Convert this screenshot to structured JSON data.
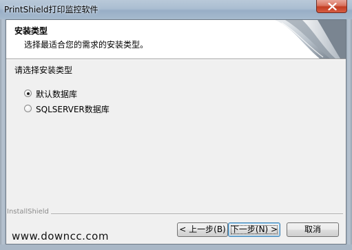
{
  "window": {
    "title": "PrintShield打印监控软件"
  },
  "header": {
    "title": "安装类型",
    "subtitle": "选择最适合您的需求的安装类型。"
  },
  "main": {
    "prompt": "请选择安装类型",
    "options": [
      {
        "label": "默认数据库",
        "selected": true
      },
      {
        "label": "SQLSERVER数据库",
        "selected": false
      }
    ]
  },
  "footer": {
    "brand": "InstallShield",
    "back_label": "< 上一步(B)",
    "next_label": "下一步(N) >",
    "cancel_label": "取消"
  },
  "watermark": "www.downcc.com"
}
